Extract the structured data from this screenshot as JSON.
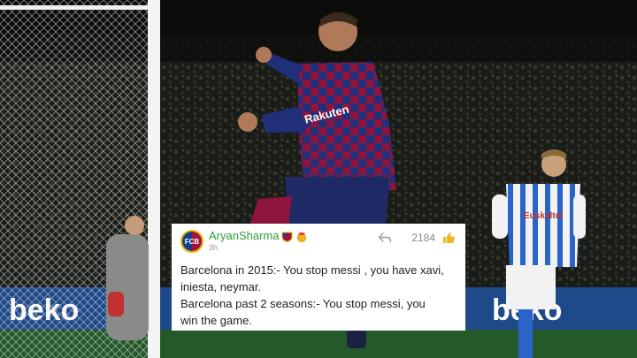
{
  "comment": {
    "avatar_text": "FCB",
    "username": "AryanSharma",
    "timestamp": "3h",
    "like_count": "2184",
    "lines": [
      "Barcelona in 2015:- You stop messi , you have xavi,",
      "iniesta, neymar.",
      "Barcelona past 2 seasons:- You stop messi, you",
      "win the game."
    ],
    "colors": {
      "username": "#2f9e3a",
      "card_bg": "#ffffff",
      "text": "#1f1f1f"
    }
  },
  "photo": {
    "boards": [
      "beko",
      "beko"
    ],
    "player_sponsor": "Rakuten",
    "opponent_sponsor": "Euskaltel"
  }
}
